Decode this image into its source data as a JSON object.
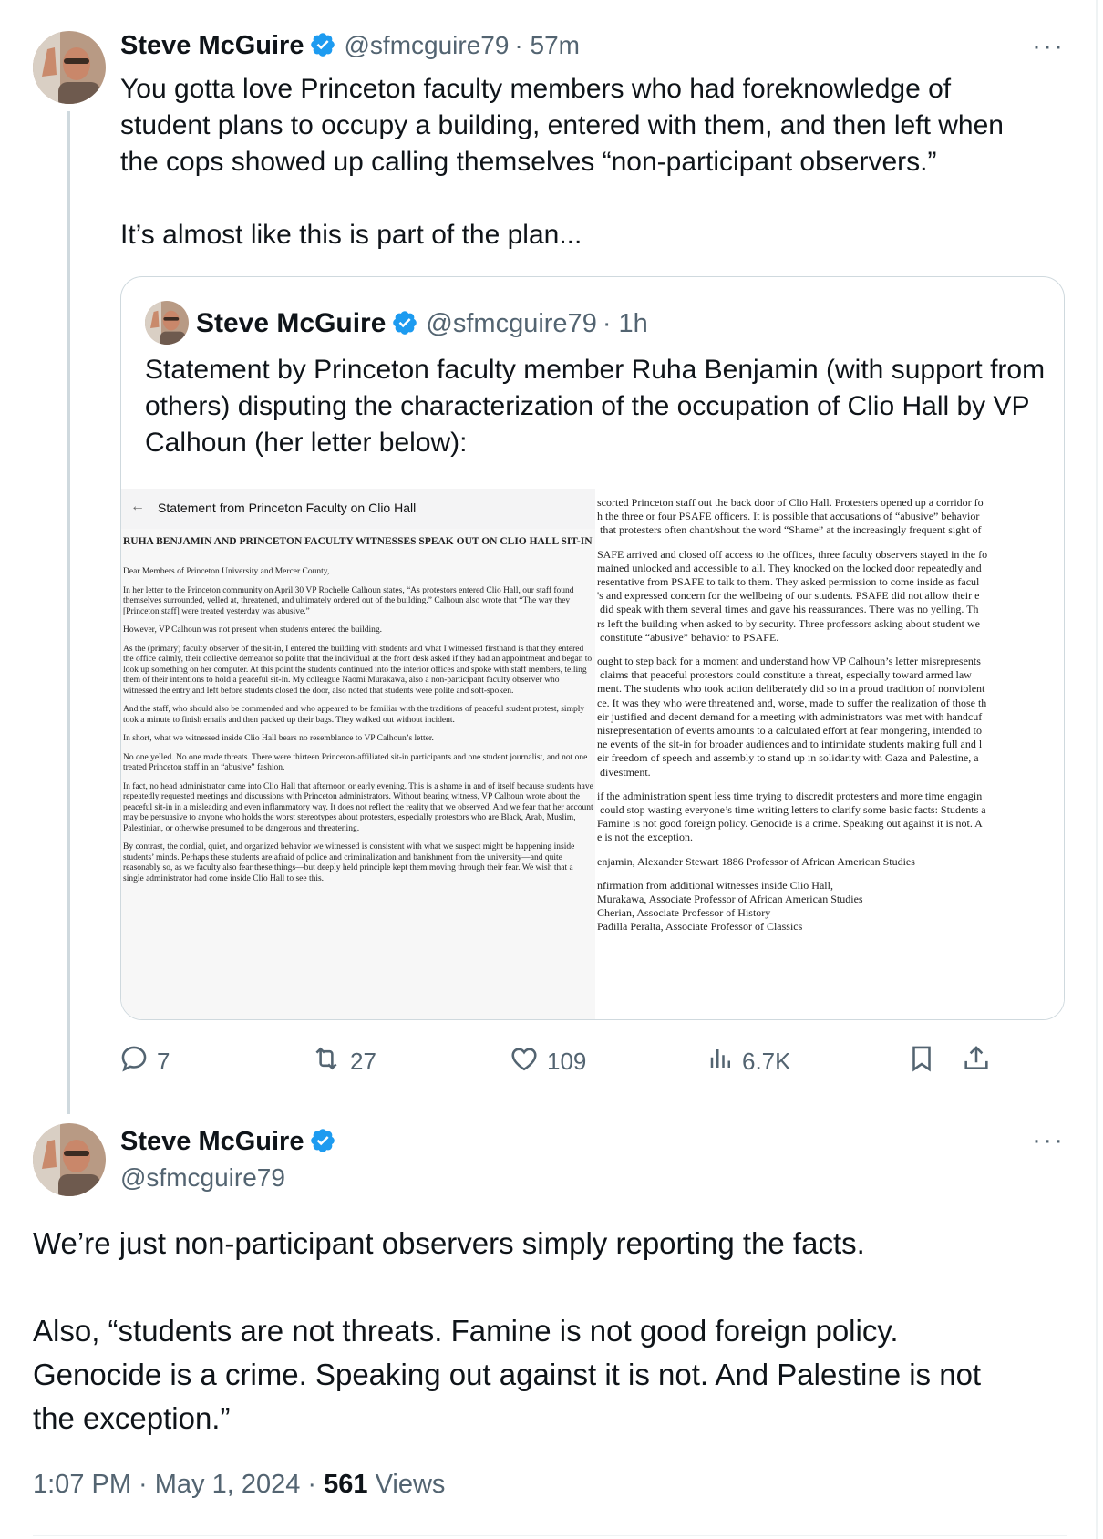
{
  "tweet1": {
    "name": "Steve McGuire",
    "handle": "@sfmcguire79",
    "time": "· 57m",
    "more_label": "···",
    "text": "You gotta love Princeton faculty members who had foreknowledge of\nstudent plans to occupy a building, entered with them, and then left when\nthe cops showed up calling themselves “non-participant observers.”\n\nIt’s almost like this is part of the plan...",
    "quote": {
      "name": "Steve McGuire",
      "handle": "@sfmcguire79",
      "time": "· 1h",
      "text": "Statement by Princeton faculty member Ruha Benjamin (with support from others) disputing the characterization of the occupation of Clio Hall by VP Calhoun (her letter below):",
      "doc": {
        "back_arrow": "←",
        "doc_title": "Statement from Princeton Faculty on Clio Hall",
        "heading": "RUHA BENJAMIN AND PRINCETON FACULTY WITNESSES SPEAK OUT ON CLIO HALL SIT-IN",
        "left_paragraphs": [
          "Dear Members of Princeton University and Mercer County,",
          "In her letter to the Princeton community on April 30 VP Rochelle Calhoun states, “As protestors entered Clio Hall, our staff found themselves surrounded, yelled at, threatened, and ultimately ordered out of the building.” Calhoun also wrote that “The way they [Princeton staff] were treated yesterday was abusive.”",
          "However, VP Calhoun was not present when students entered the building.",
          "As the (primary) faculty observer of the sit-in, I entered the building with students and what I witnessed firsthand is that they entered the office calmly, their collective demeanor so polite that the individual at the front desk asked if they had an appointment and began to look up something on her computer. At this point the students continued into the interior offices and spoke with staff members, telling them of their intentions to hold a peaceful sit-in. My colleague Naomi Murakawa, also a non-participant faculty observer who witnessed the entry and left before students closed the door, also noted that students were polite and soft-spoken.",
          "And the staff, who should also be commended and who appeared to be familiar with the traditions of peaceful student protest, simply took a minute to finish emails and then packed up their bags. They walked out without incident.",
          "In short, what we witnessed inside Clio Hall bears no resemblance to VP Calhoun’s letter.",
          "No one yelled. No one made threats. There were thirteen Princeton-affiliated sit-in participants and one student journalist, and not one treated Princeton staff in an “abusive” fashion.",
          "In fact, no head administrator came into Clio Hall that afternoon or early evening. This is a shame in and of itself because students have repeatedly requested meetings and discussions with Princeton administrators. Without bearing witness, VP Calhoun wrote about the peaceful sit-in in a misleading and even inflammatory way. It does not reflect the reality that we observed. And we fear that her account may be persuasive to anyone who holds the worst stereotypes about protesters, especially protestors who are Black, Arab, Muslim, Palestinian, or otherwise presumed to be dangerous and threatening.",
          "By contrast, the cordial, quiet, and organized behavior we witnessed is consistent with what we suspect might be happening inside students’ minds. Perhaps these students are afraid of police and criminalization and banishment from the university—and quite reasonably so, as we faculty also fear these things—but deeply held principle kept them moving through their fear. We wish that a single administrator had come inside Clio Hall to see this."
        ],
        "right_paragraphs": [
          "scorted Princeton staff out the back door of Clio Hall. Protesters opened up a corridor fo\nh the three or four PSAFE officers. It is possible that accusations of “abusive” behavior\n that protesters often chant/shout the word “Shame” at the increasingly frequent sight of",
          "SAFE arrived and closed off access to the offices, three faculty observers stayed in the fo\nmained unlocked and accessible to all. They knocked on the locked door repeatedly and\nresentative from PSAFE to talk to them. They asked permission to come inside as facul\n's and expressed concern for the wellbeing of our students. PSAFE did not allow their e\n did speak with them several times and gave his reassurances. There was no yelling. Th\nrs left the building when asked to by security. Three professors asking about student we\n constitute “abusive” behavior to PSAFE.",
          "ought to step back for a moment and understand how VP Calhoun’s letter misrepresents\n claims that peaceful protestors could constitute a threat, especially toward armed law\nment. The students who took action deliberately did so in a proud tradition of nonviolent\nce. It was they who were threatened and, worse, made to suffer the realization of those th\neir justified and decent demand for a meeting with administrators was met with handcuf\nnisrepresentation of events amounts to a calculated effort at fear mongering, intended to\nne events of the sit-in for broader audiences and to intimidate students making full and l\neir freedom of speech and assembly to stand up in solidarity with Gaza and Palestine, a\n divestment.",
          "if the administration spent less time trying to discredit protesters and more time engagin\n could stop wasting everyone’s time writing letters to clarify some basic facts: Students a\nFamine is not good foreign policy. Genocide is a crime. Speaking out against it is not. A\ne is not the exception.",
          "enjamin, Alexander Stewart 1886 Professor of African American Studies",
          "nfirmation from additional witnesses inside Clio Hall,\nMurakawa, Associate Professor of African American Studies\nCherian, Associate Professor of History\nPadilla Peralta, Associate Professor of Classics"
        ]
      }
    },
    "actions": {
      "replies": "7",
      "reposts": "27",
      "likes": "109",
      "views": "6.7K"
    }
  },
  "tweet2": {
    "name": "Steve McGuire",
    "handle": "@sfmcguire79",
    "more_label": "···",
    "text": "We’re just non-participant observers simply reporting the facts.\n\nAlso, “students are not threats. Famine is not good foreign policy.\nGenocide is a crime. Speaking out against it is not. And Palestine is not\nthe exception.”",
    "time": "1:07 PM · May 1, 2024 · ",
    "views_count": "561",
    "views_label": " Views"
  },
  "colors": {
    "verified": "#1d9bf0",
    "secondary_text": "#536471",
    "border": "#cfd9de"
  }
}
